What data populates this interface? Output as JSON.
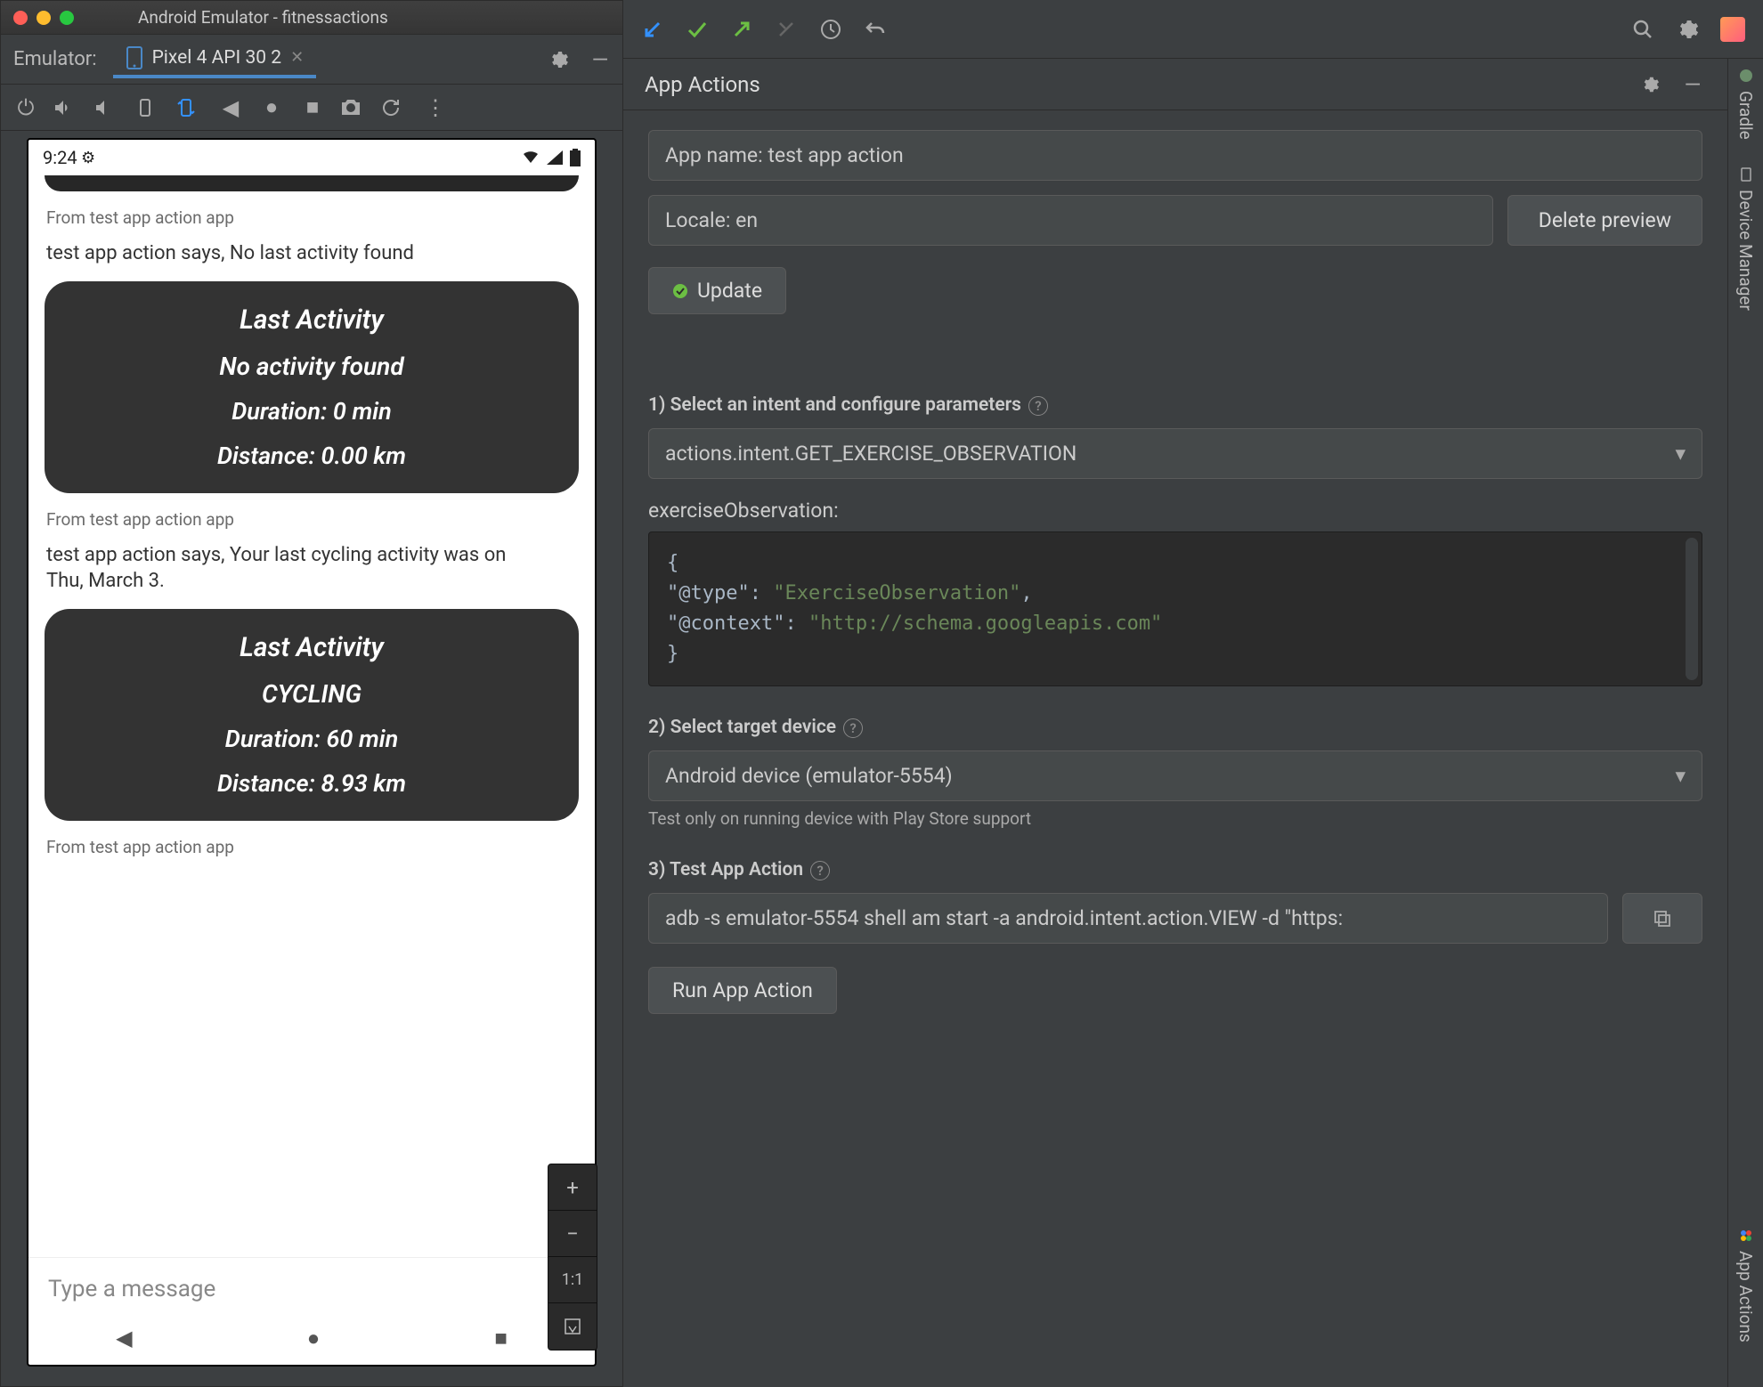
{
  "window": {
    "title": "Android Emulator - fitnessactions"
  },
  "emulator": {
    "label": "Emulator:",
    "tab": "Pixel 4 API 30 2",
    "statusbar": {
      "time": "9:24"
    },
    "chat": {
      "from_label": "From test app action app",
      "says1": "test app action says, No last activity found",
      "card1": {
        "title": "Last Activity",
        "line2": "No activity found",
        "line3": "Duration: 0 min",
        "line4": "Distance: 0.00 km"
      },
      "says2": "test app action says, Your last cycling activity was on Thu, March 3.",
      "card2": {
        "title": "Last Activity",
        "line2": "CYCLING",
        "line3": "Duration: 60 min",
        "line4": "Distance: 8.93 km"
      },
      "input_placeholder": "Type a message"
    },
    "zoom": {
      "one_to_one": "1:1"
    }
  },
  "appactions": {
    "panel_title": "App Actions",
    "app_name": "App name: test app action",
    "locale": "Locale: en",
    "delete_preview": "Delete preview",
    "update": "Update",
    "step1": "1) Select an intent and configure parameters",
    "intent": "actions.intent.GET_EXERCISE_OBSERVATION",
    "param_label": "exerciseObservation:",
    "json_line1": "{",
    "json_line2a": "    \"@type\": ",
    "json_line2b": "\"ExerciseObservation\"",
    "json_line2c": ",",
    "json_line3a": "    \"@context\": ",
    "json_line3b": "\"http://schema.googleapis.com\"",
    "json_line4": "}",
    "step2": "2) Select target device",
    "device": "Android device (emulator-5554)",
    "device_hint": "Test only on running device with Play Store support",
    "step3": "3) Test App Action",
    "adb": "adb -s emulator-5554 shell am start -a android.intent.action.VIEW -d \"https:",
    "run": "Run App Action"
  },
  "siderail": {
    "gradle": "Gradle",
    "device_manager": "Device Manager",
    "app_actions": "App Actions"
  }
}
